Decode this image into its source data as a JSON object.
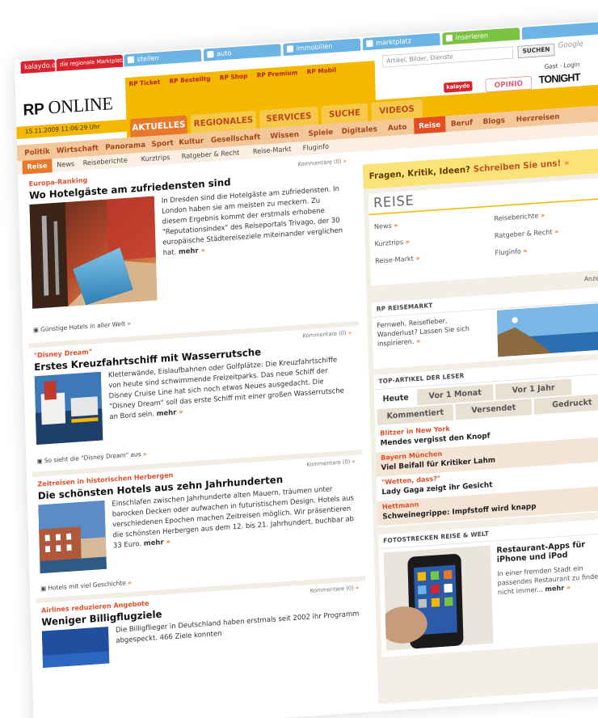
{
  "topbar": {
    "tabs": [
      {
        "label": "kalaydo.de",
        "color": "#d7242e"
      },
      {
        "label": "die regionale Marktplatz",
        "color": "#d7242e"
      },
      {
        "label": "stellen",
        "color": "#6cb4e4"
      },
      {
        "label": "auto",
        "color": "#6cb4e4"
      },
      {
        "label": "immobilien",
        "color": "#6cb4e4"
      },
      {
        "label": "marktplatz",
        "color": "#6cb4e4"
      },
      {
        "label": "inserieren",
        "color": "#7cc243"
      }
    ]
  },
  "header": {
    "logo_light": "RP",
    "logo_bold": "ONLINE",
    "links": [
      "RP Ticket",
      "RP Bestelltg",
      "RP Shop",
      "RP Premium",
      "RP Mobil"
    ],
    "search_placeholder": "Artikel, Bilder, Dienste",
    "search_button": "SUCHEN",
    "google": "Google",
    "right_links": "Gast · Login",
    "promo1": "kalaydo",
    "promo2": "OPINIO",
    "promo3": "TONIGHT",
    "datetime": "15.11.2009 11:06:29 Uhr"
  },
  "mainnav": {
    "items": [
      "AKTUELLES",
      "REGIONALES",
      "SERVICES",
      "SUCHE",
      "VIDEOS"
    ]
  },
  "secnav": {
    "items": [
      "Politik",
      "Wirtschaft",
      "Panorama",
      "Sport",
      "Kultur",
      "Gesellschaft",
      "Wissen",
      "Spiele",
      "Digitales",
      "Auto",
      "Reise",
      "Beruf",
      "Blogs",
      "Herzreisen"
    ]
  },
  "subnav3": {
    "tag": "Reise",
    "items": [
      "News",
      "Reiseberichte",
      "Kurztrips",
      "Ratgeber & Recht",
      "Reise-Markt",
      "Fluginfo"
    ]
  },
  "articles": [
    {
      "kicker": "Europa-Ranking",
      "comments": "Kommentare (0)",
      "headline": "Wo Hotelgäste am zufriedensten sind",
      "body": "In Dresden sind die Hotelgäste am zufriedensten. In London haben sie am meisten zu meckern. Zu diesem Ergebnis kommt der erstmals erhobene \"Reputationsindex\" des Reiseportals Trivago, der 30 europäische Städtereiseziele miteinander verglichen hat.",
      "more": "mehr",
      "foot": "Günstige Hotels in aller Welt"
    },
    {
      "kicker": "\"Disney Dream\"",
      "comments": "Kommentare (0)",
      "headline": "Erstes Kreuzfahrtschiff mit Wasserrutsche",
      "body": "Kletterwände, Eislaufbahnen oder Golfplätze: Die Kreuzfahrtschiffe von heute sind schwimmende Freizeitparks. Das neue Schiff der Disney Cruise Line hat sich noch etwas Neues ausgedacht. Die \"Disney Dream\" soll das erste Schiff mit einer großen Wasserrutsche an Bord sein.",
      "more": "mehr",
      "foot": "So sieht die \"Disney Dream\" aus"
    },
    {
      "kicker": "Zeitreisen in historischen Herbergen",
      "comments": "Kommentare (0)",
      "headline": "Die schönsten Hotels aus zehn Jahrhunderten",
      "body": "Einschlafen zwischen Jahrhunderte alten Mauern, träumen unter barocken Decken oder aufwachen in futuristischem Design. Hotels aus verschiedenen Epochen machen Zeitreisen möglich. Wir präsentieren die schönsten Herbergen aus dem 12. bis 21. Jahrhundert, buchbar ab 33 Euro.",
      "more": "mehr",
      "foot": "Hotels mit viel Geschichte"
    },
    {
      "kicker": "Airlines reduzieren Angebote",
      "comments": "Kommentare (0)",
      "headline": "Weniger Billigflugziele",
      "body": "Die Billigflieger in Deutschland haben erstmals seit 2002 ihr Programm abgespeckt. 466 Ziele konnten"
    }
  ],
  "right": {
    "feedback_a": "Fragen, Kritik, Ideen?",
    "feedback_b": "Schreiben Sie uns!",
    "reise_title": "REISE",
    "reise_links": [
      "News",
      "Reiseberichte",
      "Kurztrips",
      "Ratgeber & Recht",
      "Reise-Markt",
      "Fluginfo"
    ],
    "anzeige": "Anzeige",
    "markt_title": "RP REISEMARKT",
    "markt_text": "Fernweh, Reisefieber, Wanderlust? Lassen Sie sich inspirieren.",
    "top_title": "TOP-ARTIKEL DER LESER",
    "tabs_row1": [
      "Heute",
      "Vor 1 Monat",
      "Vor 1 Jahr"
    ],
    "tabs_row2": [
      "Kommentiert",
      "Versendet",
      "Gedruckt"
    ],
    "top_items": [
      {
        "cat": "Blitzer in New York",
        "title": "Mendes vergisst den Knopf"
      },
      {
        "cat": "Bayern München",
        "title": "Viel Beifall für Kritiker Lahm"
      },
      {
        "cat": "\"Wetten, dass?\"",
        "title": "Lady Gaga zeigt ihr Gesicht"
      },
      {
        "cat": "Hettmann",
        "title": "Schweinegrippe: Impfstoff wird knapp"
      }
    ],
    "foto_title": "FOTOSTRECKEN REISE & WELT",
    "foto_headline": "Restaurant-Apps für iPhone und iPod",
    "foto_text": "In einer fremden Stadt ein passendes Restaurant zu finden, ist nicht immer...",
    "foto_more": "mehr"
  }
}
